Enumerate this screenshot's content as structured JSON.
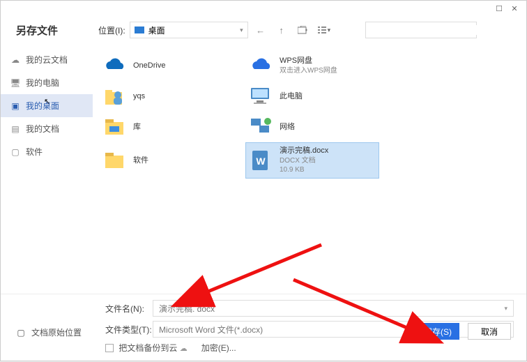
{
  "window": {
    "title": "另存文件"
  },
  "location": {
    "label": "位置(I):",
    "value": "桌面"
  },
  "search": {
    "placeholder": ""
  },
  "sidebar": {
    "items": [
      {
        "label": "我的云文档"
      },
      {
        "label": "我的电脑"
      },
      {
        "label": "我的桌面"
      },
      {
        "label": "我的文档"
      },
      {
        "label": "软件"
      }
    ]
  },
  "files": [
    {
      "name": "OneDrive"
    },
    {
      "name": "WPS网盘",
      "sub1": "双击进入WPS网盘"
    },
    {
      "name": "yqs"
    },
    {
      "name": "此电脑"
    },
    {
      "name": "库"
    },
    {
      "name": "网络"
    },
    {
      "name": "软件"
    },
    {
      "name": "演示完稿.docx",
      "sub1": "DOCX 文档",
      "sub2": "10.9 KB"
    }
  ],
  "form": {
    "filename_label": "文件名(N):",
    "filename_value": "演示完稿. docx",
    "filetype_label": "文件类型(T):",
    "filetype_value": "Microsoft Word 文件(*.docx)",
    "backup_label": "把文档备份到云",
    "encrypt_label": "加密(E)..."
  },
  "footer": {
    "orig_loc_label": "文档原始位置"
  },
  "buttons": {
    "save": "保存(S)",
    "cancel": "取消"
  }
}
